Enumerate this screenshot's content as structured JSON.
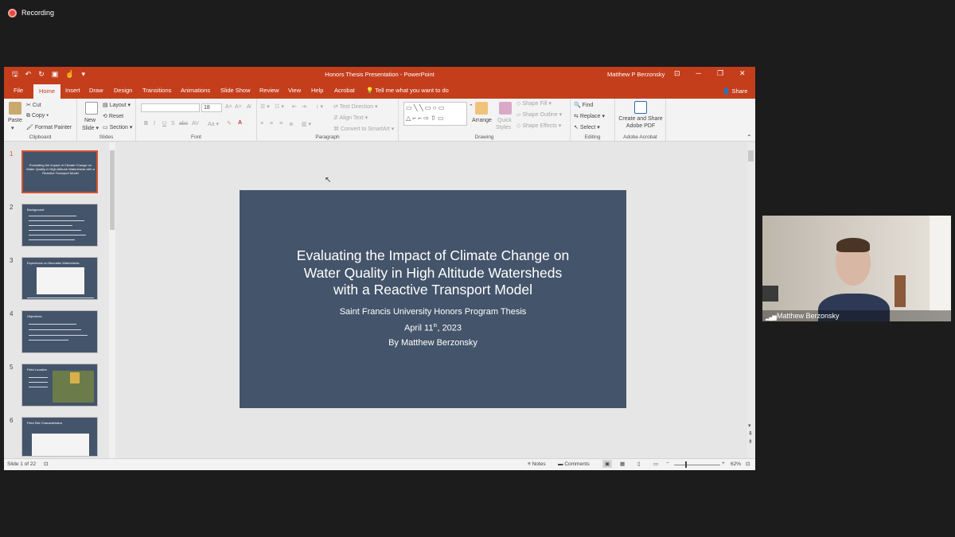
{
  "recording": {
    "label": "Recording"
  },
  "window": {
    "title": "Honors Thesis Presentation  -  PowerPoint",
    "user": "Matthew P Berzonsky"
  },
  "tabs": [
    "File",
    "Home",
    "Insert",
    "Draw",
    "Design",
    "Transitions",
    "Animations",
    "Slide Show",
    "Review",
    "View",
    "Help",
    "Acrobat"
  ],
  "active_tab": "Home",
  "tell_me": "Tell me what you want to do",
  "share": "Share",
  "ribbon": {
    "clipboard": {
      "label": "Clipboard",
      "paste": "Paste",
      "cut": "Cut",
      "copy": "Copy",
      "format_painter": "Format Painter"
    },
    "slides": {
      "label": "Slides",
      "new_slide": "New",
      "new_slide2": "Slide",
      "layout": "Layout",
      "reset": "Reset",
      "section": "Section"
    },
    "font": {
      "label": "Font",
      "size": "18",
      "buttons": [
        "B",
        "I",
        "U",
        "S",
        "abc",
        "AV"
      ]
    },
    "paragraph": {
      "label": "Paragraph",
      "text_direction": "Text Direction",
      "align_text": "Align Text",
      "convert_smartart": "Convert to SmartArt"
    },
    "drawing": {
      "label": "Drawing",
      "arrange": "Arrange",
      "quick_styles": "Quick",
      "quick_styles2": "Styles",
      "shape_fill": "Shape Fill",
      "shape_outline": "Shape Outline",
      "shape_effects": "Shape Effects"
    },
    "editing": {
      "label": "Editing",
      "find": "Find",
      "replace": "Replace",
      "select": "Select"
    },
    "acrobat": {
      "label": "Adobe Acrobat",
      "create": "Create and Share",
      "create2": "Adobe PDF"
    }
  },
  "thumbnails": [
    {
      "num": "1",
      "title": "Evaluating the Impact of Climate Change on Water Quality in High Altitude Watersheds with a Reactive Transport Model"
    },
    {
      "num": "2",
      "title": "Background"
    },
    {
      "num": "3",
      "title": "Experience on Mountain Watersheds"
    },
    {
      "num": "4",
      "title": "Objectives"
    },
    {
      "num": "5",
      "title": "Field Location"
    },
    {
      "num": "6",
      "title": "Field Site Characteristics"
    }
  ],
  "slide": {
    "title_lines": [
      "Evaluating the Impact of Climate Change on",
      "Water Quality in High Altitude Watersheds",
      "with a Reactive Transport Model"
    ],
    "subtitle1": "Saint Francis University Honors Program Thesis",
    "date_pre": "April 11",
    "date_sup": "th",
    "date_post": ", 2023",
    "author": "By Matthew Berzonsky"
  },
  "status": {
    "slide_count": "Slide 1 of 22",
    "notes": "Notes",
    "comments": "Comments",
    "zoom": "62%"
  },
  "video": {
    "name": "Matthew Berzonsky"
  },
  "colors": {
    "ppt_accent": "#c43e1c",
    "slide_bg": "#44546a",
    "selection": "#d35230"
  }
}
